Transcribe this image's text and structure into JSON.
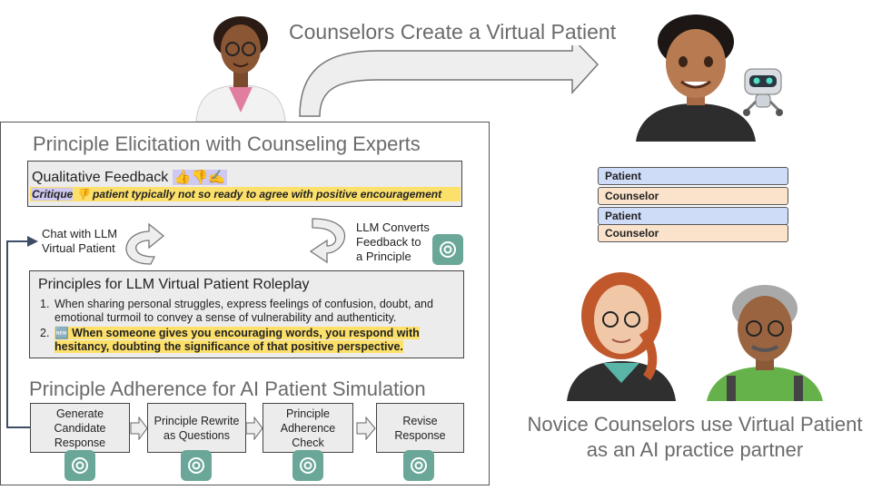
{
  "top_title": "Counselors Create a Virtual Patient",
  "elicitation": {
    "title": "Principle Elicitation with Counseling Experts",
    "feedback_label": "Qualitative Feedback",
    "feedback_emojis": "👍👎✍️",
    "critique_label": "Critique",
    "critique_emoji": "👎",
    "critique_text": "patient typically not so ready to agree with positive encouragement",
    "chat_label_1": "Chat with LLM",
    "chat_label_2": "Virtual Patient",
    "convert_label_1": "LLM Converts",
    "convert_label_2": "Feedback to",
    "convert_label_3": "a Principle",
    "principles_title": "Principles for LLM Virtual Patient Roleplay",
    "principles": [
      {
        "num": "1.",
        "text": "When sharing personal struggles, express feelings of confusion, doubt, and emotional turmoil to convey a sense of vulnerability and authenticity."
      },
      {
        "num": "2.",
        "badge": "🆕",
        "text": "When someone gives you encouraging words, you respond with hesitancy, doubting the significance of that positive perspective."
      }
    ]
  },
  "adherence": {
    "title": "Principle Adherence for AI Patient Simulation",
    "steps": [
      "Generate Candidate Response",
      "Principle Rewrite as Questions",
      "Principle Adherence Check",
      "Revise Response"
    ]
  },
  "chat_preview": {
    "rows": [
      {
        "role": "Patient"
      },
      {
        "role": "Counselor"
      },
      {
        "role": "Patient"
      },
      {
        "role": "Counselor"
      }
    ]
  },
  "bottom_caption": "Novice Counselors use Virtual Patient as an AI practice partner",
  "colors": {
    "patient": "#cfdcf8",
    "counselor": "#fbe3cb",
    "highlight": "#fde06a",
    "gpt": "#6aa798"
  }
}
